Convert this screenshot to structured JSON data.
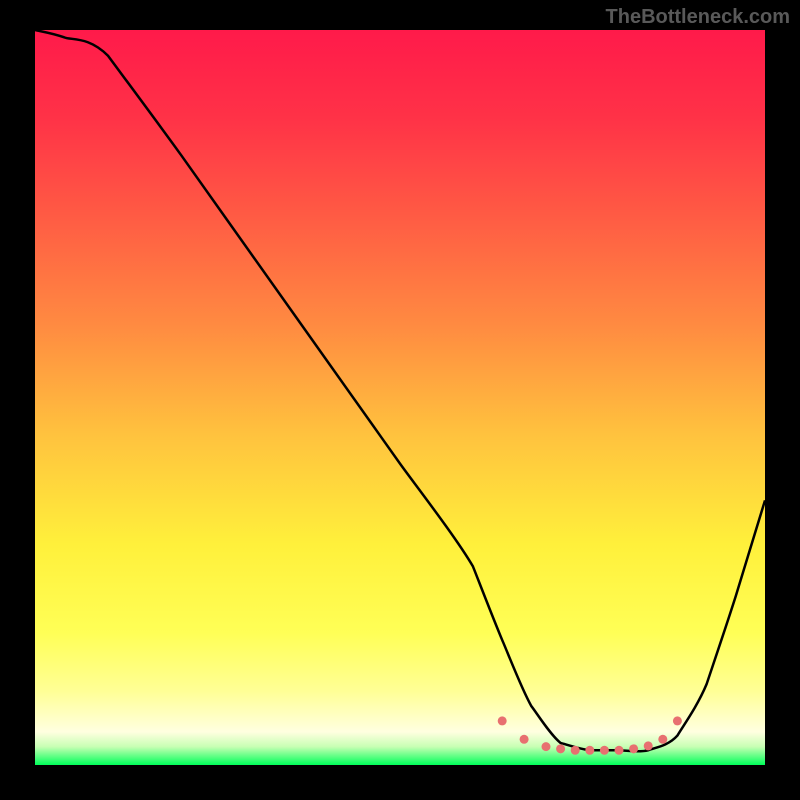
{
  "watermark": "TheBottleneck.com",
  "chart_data": {
    "type": "line",
    "title": "",
    "xlabel": "",
    "ylabel": "",
    "xlim": [
      0,
      100
    ],
    "ylim": [
      0,
      100
    ],
    "background_gradient": {
      "stops": [
        {
          "offset": 0.0,
          "color": "#ff1a4a"
        },
        {
          "offset": 0.12,
          "color": "#ff3247"
        },
        {
          "offset": 0.25,
          "color": "#ff5a44"
        },
        {
          "offset": 0.4,
          "color": "#ff8a41"
        },
        {
          "offset": 0.55,
          "color": "#ffc23e"
        },
        {
          "offset": 0.7,
          "color": "#fff03b"
        },
        {
          "offset": 0.82,
          "color": "#ffff56"
        },
        {
          "offset": 0.9,
          "color": "#ffff96"
        },
        {
          "offset": 0.955,
          "color": "#ffffe0"
        },
        {
          "offset": 0.975,
          "color": "#c8ffb4"
        },
        {
          "offset": 1.0,
          "color": "#00ff5a"
        }
      ]
    },
    "series": [
      {
        "name": "bottleneck-curve",
        "x": [
          0,
          4,
          10,
          20,
          30,
          40,
          50,
          60,
          64,
          68,
          72,
          76,
          80,
          84,
          88,
          92,
          96,
          100
        ],
        "y": [
          100,
          99,
          96.5,
          83,
          69,
          55,
          41,
          27,
          17,
          8,
          3,
          2,
          2,
          2,
          4,
          11,
          23,
          36
        ],
        "style": "solid",
        "color": "#000000"
      },
      {
        "name": "optimal-range-dots",
        "x": [
          64,
          67,
          70,
          72,
          74,
          76,
          78,
          80,
          82,
          84,
          86,
          88
        ],
        "y": [
          6,
          3.5,
          2.5,
          2.2,
          2,
          2,
          2,
          2,
          2.2,
          2.6,
          3.5,
          6
        ],
        "style": "dotted",
        "color": "#e87070"
      }
    ]
  }
}
